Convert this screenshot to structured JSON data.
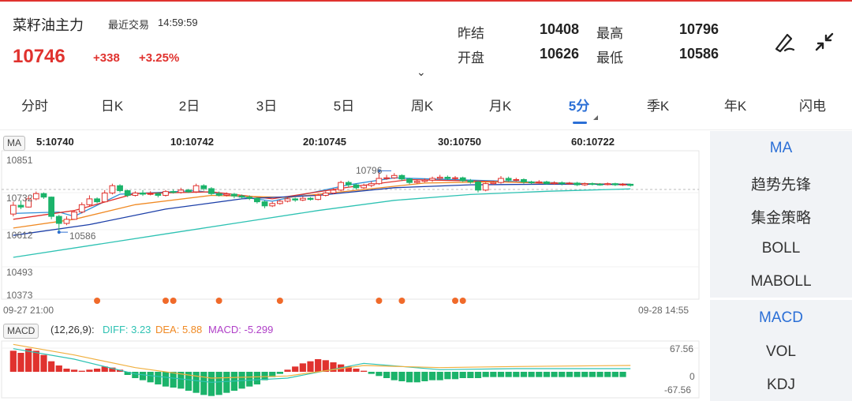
{
  "header": {
    "name": "菜籽油主力",
    "trade_label": "最近交易",
    "trade_time": "14:59:59",
    "price": "10746",
    "change": "+338",
    "change_pct": "+3.25%",
    "stats": [
      {
        "label": "昨结",
        "value": "10408"
      },
      {
        "label": "最高",
        "value": "10796"
      },
      {
        "label": "开盘",
        "value": "10626"
      },
      {
        "label": "最低",
        "value": "10586"
      }
    ],
    "icons": [
      "draw-tool-icon",
      "collapse-icon"
    ]
  },
  "tabs": [
    "分时",
    "日K",
    "2日",
    "3日",
    "5日",
    "周K",
    "月K",
    "5分",
    "季K",
    "年K",
    "闪电"
  ],
  "active_tab": "5分",
  "side_main": [
    "MA",
    "趋势先锋",
    "集金策略",
    "BOLL",
    "MABOLL"
  ],
  "side_sub": [
    "MACD",
    "VOL",
    "KDJ"
  ],
  "chart": {
    "indicator": "MA",
    "legend": [
      {
        "label": "5:10740",
        "color": "#2f8fd8"
      },
      {
        "label": "10:10742",
        "color": "#e0322e"
      },
      {
        "label": "20:10745",
        "color": "#f08a24"
      },
      {
        "label": "30:10750",
        "color": "#1c3fa8"
      },
      {
        "label": "60:10722",
        "color": "#2ec2b3"
      }
    ],
    "y_ticks": [
      "10851",
      "10732",
      "10612",
      "10493",
      "10373"
    ],
    "high_label": "10796",
    "low_label": "10586",
    "time_start": "09-27 21:00",
    "time_end": "09-28 14:55",
    "up_color": "#e0322e",
    "down_color": "#1bb36a"
  },
  "macd": {
    "tag": "MACD",
    "params": "(12,26,9):",
    "diff": "DIFF: 3.23",
    "dea": "DEA: 5.88",
    "macd": "MACD: -5.299",
    "y_ticks": [
      "67.56",
      "0",
      "-67.56"
    ]
  },
  "chart_data": {
    "type": "candlestick",
    "y_range": [
      10373,
      10851
    ],
    "candles": [
      [
        10648,
        10678,
        10690,
        10640
      ],
      [
        10678,
        10672,
        10695,
        10665
      ],
      [
        10672,
        10700,
        10710,
        10670
      ],
      [
        10700,
        10718,
        10725,
        10695
      ],
      [
        10718,
        10706,
        10722,
        10700
      ],
      [
        10706,
        10640,
        10708,
        10630
      ],
      [
        10640,
        10616,
        10645,
        10586
      ],
      [
        10616,
        10630,
        10640,
        10610
      ],
      [
        10630,
        10655,
        10662,
        10628
      ],
      [
        10655,
        10680,
        10688,
        10650
      ],
      [
        10680,
        10700,
        10712,
        10676
      ],
      [
        10700,
        10690,
        10705,
        10685
      ],
      [
        10690,
        10720,
        10730,
        10688
      ],
      [
        10720,
        10745,
        10752,
        10715
      ],
      [
        10745,
        10728,
        10750,
        10722
      ],
      [
        10728,
        10712,
        10732,
        10706
      ],
      [
        10712,
        10720,
        10726,
        10708
      ],
      [
        10720,
        10716,
        10730,
        10710
      ],
      [
        10716,
        10718,
        10726,
        10712
      ],
      [
        10718,
        10712,
        10722,
        10705
      ],
      [
        10712,
        10725,
        10730,
        10708
      ],
      [
        10725,
        10722,
        10732,
        10718
      ],
      [
        10722,
        10730,
        10738,
        10718
      ],
      [
        10730,
        10724,
        10734,
        10720
      ],
      [
        10724,
        10745,
        10752,
        10720
      ],
      [
        10745,
        10735,
        10750,
        10728
      ],
      [
        10735,
        10718,
        10740,
        10712
      ],
      [
        10718,
        10712,
        10725,
        10708
      ],
      [
        10712,
        10716,
        10722,
        10708
      ],
      [
        10716,
        10710,
        10720,
        10702
      ],
      [
        10710,
        10706,
        10715,
        10700
      ],
      [
        10706,
        10702,
        10712,
        10696
      ],
      [
        10702,
        10690,
        10706,
        10684
      ],
      [
        10690,
        10676,
        10694,
        10668
      ],
      [
        10676,
        10684,
        10690,
        10672
      ],
      [
        10684,
        10692,
        10698,
        10680
      ],
      [
        10692,
        10700,
        10706,
        10688
      ],
      [
        10700,
        10696,
        10704,
        10690
      ],
      [
        10696,
        10702,
        10708,
        10692
      ],
      [
        10702,
        10698,
        10706,
        10694
      ],
      [
        10698,
        10712,
        10718,
        10695
      ],
      [
        10712,
        10720,
        10726,
        10708
      ],
      [
        10720,
        10730,
        10736,
        10716
      ],
      [
        10730,
        10756,
        10762,
        10726
      ],
      [
        10756,
        10748,
        10762,
        10740
      ],
      [
        10748,
        10738,
        10752,
        10732
      ],
      [
        10738,
        10746,
        10752,
        10734
      ],
      [
        10746,
        10752,
        10760,
        10740
      ],
      [
        10752,
        10770,
        10796,
        10748
      ],
      [
        10770,
        10772,
        10782,
        10765
      ],
      [
        10772,
        10780,
        10788,
        10768
      ],
      [
        10780,
        10768,
        10784,
        10762
      ],
      [
        10768,
        10756,
        10772,
        10750
      ],
      [
        10756,
        10760,
        10766,
        10752
      ],
      [
        10760,
        10764,
        10770,
        10756
      ],
      [
        10764,
        10770,
        10776,
        10758
      ],
      [
        10770,
        10774,
        10782,
        10766
      ],
      [
        10774,
        10770,
        10780,
        10764
      ],
      [
        10770,
        10772,
        10778,
        10764
      ],
      [
        10772,
        10762,
        10776,
        10758
      ],
      [
        10762,
        10758,
        10768,
        10752
      ],
      [
        10758,
        10730,
        10762,
        10722
      ],
      [
        10730,
        10752,
        10756,
        10726
      ],
      [
        10752,
        10756,
        10762,
        10748
      ],
      [
        10756,
        10770,
        10778,
        10752
      ],
      [
        10770,
        10764,
        10776,
        10758
      ],
      [
        10764,
        10766,
        10772,
        10760
      ],
      [
        10766,
        10758,
        10770,
        10752
      ],
      [
        10758,
        10755,
        10762,
        10750
      ],
      [
        10755,
        10758,
        10764,
        10752
      ],
      [
        10758,
        10752,
        10762,
        10748
      ],
      [
        10752,
        10755,
        10760,
        10748
      ],
      [
        10755,
        10752,
        10760,
        10746
      ],
      [
        10752,
        10754,
        10758,
        10748
      ],
      [
        10754,
        10748,
        10758,
        10744
      ],
      [
        10748,
        10752,
        10756,
        10744
      ],
      [
        10752,
        10750,
        10756,
        10746
      ],
      [
        10750,
        10749,
        10754,
        10745
      ],
      [
        10749,
        10752,
        10756,
        10746
      ],
      [
        10752,
        10748,
        10755,
        10744
      ],
      [
        10748,
        10750,
        10754,
        10744
      ],
      [
        10750,
        10746,
        10752,
        10742
      ]
    ],
    "ma_lines": {
      "ma5": [
        [
          0,
          10650
        ],
        [
          6,
          10655
        ],
        [
          8,
          10640
        ],
        [
          14,
          10716
        ],
        [
          24,
          10728
        ],
        [
          34,
          10692
        ],
        [
          44,
          10748
        ],
        [
          50,
          10772
        ],
        [
          60,
          10764
        ],
        [
          70,
          10756
        ],
        [
          81,
          10748
        ]
      ],
      "ma10": [
        [
          0,
          10630
        ],
        [
          8,
          10660
        ],
        [
          16,
          10718
        ],
        [
          26,
          10724
        ],
        [
          34,
          10700
        ],
        [
          44,
          10740
        ],
        [
          52,
          10766
        ],
        [
          62,
          10760
        ],
        [
          72,
          10752
        ],
        [
          81,
          10748
        ]
      ],
      "ma20": [
        [
          0,
          10600
        ],
        [
          8,
          10630
        ],
        [
          16,
          10680
        ],
        [
          26,
          10712
        ],
        [
          36,
          10705
        ],
        [
          46,
          10732
        ],
        [
          54,
          10754
        ],
        [
          64,
          10758
        ],
        [
          74,
          10752
        ],
        [
          81,
          10750
        ]
      ],
      "ma30": [
        [
          0,
          10575
        ],
        [
          10,
          10612
        ],
        [
          20,
          10665
        ],
        [
          30,
          10700
        ],
        [
          40,
          10712
        ],
        [
          50,
          10738
        ],
        [
          60,
          10748
        ],
        [
          70,
          10750
        ],
        [
          81,
          10750
        ]
      ],
      "ma60": [
        [
          0,
          10500
        ],
        [
          10,
          10540
        ],
        [
          20,
          10580
        ],
        [
          30,
          10620
        ],
        [
          40,
          10660
        ],
        [
          50,
          10695
        ],
        [
          60,
          10715
        ],
        [
          70,
          10726
        ],
        [
          81,
          10734
        ]
      ]
    },
    "signal_markers": [
      11,
      20,
      21,
      27,
      35,
      48,
      51,
      58,
      59
    ],
    "macd_hist": [
      20,
      18,
      22,
      20,
      16,
      10,
      6,
      3,
      2,
      1,
      2,
      3,
      5,
      4,
      2,
      -3,
      -6,
      -8,
      -10,
      -12,
      -14,
      -15,
      -16,
      -18,
      -20,
      -22,
      -23,
      -22,
      -20,
      -18,
      -16,
      -14,
      -12,
      -8,
      -5,
      -2,
      2,
      5,
      8,
      10,
      12,
      11,
      9,
      7,
      5,
      3,
      1,
      -2,
      -4,
      -6,
      -8,
      -9,
      -10,
      -10,
      -9,
      -8,
      -8,
      -7,
      -7,
      -6,
      -6,
      -6,
      -5,
      -5,
      -5,
      -5,
      -5,
      -5,
      -5,
      -5,
      -5,
      -5,
      -5,
      -5,
      -5,
      -5,
      -5,
      -5,
      -5,
      -5,
      -5
    ],
    "macd_diff": [
      [
        0,
        22
      ],
      [
        8,
        12
      ],
      [
        16,
        -2
      ],
      [
        26,
        -10
      ],
      [
        36,
        -6
      ],
      [
        46,
        8
      ],
      [
        56,
        2
      ],
      [
        66,
        3
      ],
      [
        81,
        3
      ]
    ],
    "macd_dea": [
      [
        0,
        26
      ],
      [
        8,
        16
      ],
      [
        16,
        4
      ],
      [
        26,
        -6
      ],
      [
        36,
        -4
      ],
      [
        46,
        6
      ],
      [
        56,
        4
      ],
      [
        66,
        5
      ],
      [
        81,
        6
      ]
    ]
  }
}
